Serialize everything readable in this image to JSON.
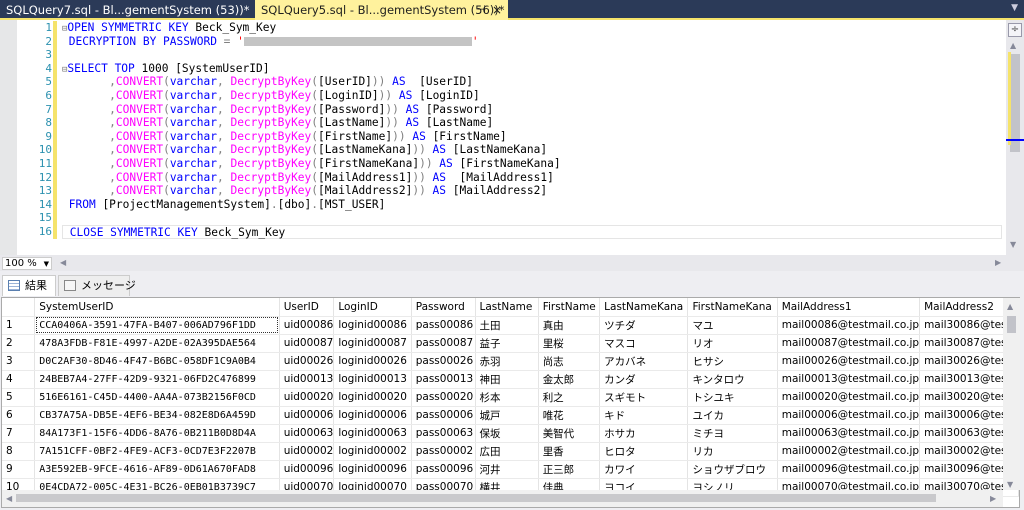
{
  "tabs": [
    {
      "label": "SQLQuery7.sql - Bl...gementSystem (53))*",
      "active": false
    },
    {
      "label": "SQLQuery5.sql - Bl...gementSystem (56))*",
      "active": true
    }
  ],
  "tab_pin_icon": "pin-icon",
  "tab_close_icon": "×",
  "editor": {
    "line_numbers": [
      "1",
      "2",
      "3",
      "4",
      "5",
      "6",
      "7",
      "8",
      "9",
      "10",
      "11",
      "12",
      "13",
      "14",
      "15",
      "16"
    ],
    "lines": [
      [
        {
          "c": "fold",
          "t": "⊟"
        },
        {
          "c": "kw",
          "t": "OPEN SYMMETRIC KEY "
        },
        {
          "c": "tx",
          "t": "Beck_Sym_Key"
        }
      ],
      [
        {
          "c": "tx",
          "t": " "
        },
        {
          "c": "kw",
          "t": "DECRYPTION BY PASSWORD "
        },
        {
          "c": "gr",
          "t": "= "
        },
        {
          "c": "str",
          "t": "'"
        },
        {
          "c": "redact",
          "t": ""
        },
        {
          "c": "str",
          "t": "'"
        }
      ],
      [],
      [
        {
          "c": "fold",
          "t": "⊟"
        },
        {
          "c": "kw",
          "t": "SELECT TOP "
        },
        {
          "c": "tx",
          "t": "1000 [SystemUserID]"
        }
      ],
      [
        {
          "c": "tx",
          "t": "       "
        },
        {
          "c": "gr",
          "t": ","
        },
        {
          "c": "fn",
          "t": "CONVERT"
        },
        {
          "c": "gr",
          "t": "("
        },
        {
          "c": "kw",
          "t": "varchar"
        },
        {
          "c": "gr",
          "t": ", "
        },
        {
          "c": "fn",
          "t": "DecryptByKey"
        },
        {
          "c": "gr",
          "t": "("
        },
        {
          "c": "tx",
          "t": "[UserID]"
        },
        {
          "c": "gr",
          "t": ")) "
        },
        {
          "c": "kw",
          "t": "AS"
        },
        {
          "c": "tx",
          "t": "  [UserID]"
        }
      ],
      [
        {
          "c": "tx",
          "t": "       "
        },
        {
          "c": "gr",
          "t": ","
        },
        {
          "c": "fn",
          "t": "CONVERT"
        },
        {
          "c": "gr",
          "t": "("
        },
        {
          "c": "kw",
          "t": "varchar"
        },
        {
          "c": "gr",
          "t": ", "
        },
        {
          "c": "fn",
          "t": "DecryptByKey"
        },
        {
          "c": "gr",
          "t": "("
        },
        {
          "c": "tx",
          "t": "[LoginID]"
        },
        {
          "c": "gr",
          "t": ")) "
        },
        {
          "c": "kw",
          "t": "AS"
        },
        {
          "c": "tx",
          "t": " [LoginID]"
        }
      ],
      [
        {
          "c": "tx",
          "t": "       "
        },
        {
          "c": "gr",
          "t": ","
        },
        {
          "c": "fn",
          "t": "CONVERT"
        },
        {
          "c": "gr",
          "t": "("
        },
        {
          "c": "kw",
          "t": "varchar"
        },
        {
          "c": "gr",
          "t": ", "
        },
        {
          "c": "fn",
          "t": "DecryptByKey"
        },
        {
          "c": "gr",
          "t": "("
        },
        {
          "c": "tx",
          "t": "[Password]"
        },
        {
          "c": "gr",
          "t": ")) "
        },
        {
          "c": "kw",
          "t": "AS"
        },
        {
          "c": "tx",
          "t": " [Password]"
        }
      ],
      [
        {
          "c": "tx",
          "t": "       "
        },
        {
          "c": "gr",
          "t": ","
        },
        {
          "c": "fn",
          "t": "CONVERT"
        },
        {
          "c": "gr",
          "t": "("
        },
        {
          "c": "kw",
          "t": "varchar"
        },
        {
          "c": "gr",
          "t": ", "
        },
        {
          "c": "fn",
          "t": "DecryptByKey"
        },
        {
          "c": "gr",
          "t": "("
        },
        {
          "c": "tx",
          "t": "[LastName]"
        },
        {
          "c": "gr",
          "t": ")) "
        },
        {
          "c": "kw",
          "t": "AS"
        },
        {
          "c": "tx",
          "t": " [LastName]"
        }
      ],
      [
        {
          "c": "tx",
          "t": "       "
        },
        {
          "c": "gr",
          "t": ","
        },
        {
          "c": "fn",
          "t": "CONVERT"
        },
        {
          "c": "gr",
          "t": "("
        },
        {
          "c": "kw",
          "t": "varchar"
        },
        {
          "c": "gr",
          "t": ", "
        },
        {
          "c": "fn",
          "t": "DecryptByKey"
        },
        {
          "c": "gr",
          "t": "("
        },
        {
          "c": "tx",
          "t": "[FirstName]"
        },
        {
          "c": "gr",
          "t": ")) "
        },
        {
          "c": "kw",
          "t": "AS"
        },
        {
          "c": "tx",
          "t": " [FirstName]"
        }
      ],
      [
        {
          "c": "tx",
          "t": "       "
        },
        {
          "c": "gr",
          "t": ","
        },
        {
          "c": "fn",
          "t": "CONVERT"
        },
        {
          "c": "gr",
          "t": "("
        },
        {
          "c": "kw",
          "t": "varchar"
        },
        {
          "c": "gr",
          "t": ", "
        },
        {
          "c": "fn",
          "t": "DecryptByKey"
        },
        {
          "c": "gr",
          "t": "("
        },
        {
          "c": "tx",
          "t": "[LastNameKana]"
        },
        {
          "c": "gr",
          "t": ")) "
        },
        {
          "c": "kw",
          "t": "AS"
        },
        {
          "c": "tx",
          "t": " [LastNameKana]"
        }
      ],
      [
        {
          "c": "tx",
          "t": "       "
        },
        {
          "c": "gr",
          "t": ","
        },
        {
          "c": "fn",
          "t": "CONVERT"
        },
        {
          "c": "gr",
          "t": "("
        },
        {
          "c": "kw",
          "t": "varchar"
        },
        {
          "c": "gr",
          "t": ", "
        },
        {
          "c": "fn",
          "t": "DecryptByKey"
        },
        {
          "c": "gr",
          "t": "("
        },
        {
          "c": "tx",
          "t": "[FirstNameKana]"
        },
        {
          "c": "gr",
          "t": ")) "
        },
        {
          "c": "kw",
          "t": "AS"
        },
        {
          "c": "tx",
          "t": " [FirstNameKana]"
        }
      ],
      [
        {
          "c": "tx",
          "t": "       "
        },
        {
          "c": "gr",
          "t": ","
        },
        {
          "c": "fn",
          "t": "CONVERT"
        },
        {
          "c": "gr",
          "t": "("
        },
        {
          "c": "kw",
          "t": "varchar"
        },
        {
          "c": "gr",
          "t": ", "
        },
        {
          "c": "fn",
          "t": "DecryptByKey"
        },
        {
          "c": "gr",
          "t": "("
        },
        {
          "c": "tx",
          "t": "[MailAddress1]"
        },
        {
          "c": "gr",
          "t": ")) "
        },
        {
          "c": "kw",
          "t": "AS"
        },
        {
          "c": "tx",
          "t": "  [MailAddress1]"
        }
      ],
      [
        {
          "c": "tx",
          "t": "       "
        },
        {
          "c": "gr",
          "t": ","
        },
        {
          "c": "fn",
          "t": "CONVERT"
        },
        {
          "c": "gr",
          "t": "("
        },
        {
          "c": "kw",
          "t": "varchar"
        },
        {
          "c": "gr",
          "t": ", "
        },
        {
          "c": "fn",
          "t": "DecryptByKey"
        },
        {
          "c": "gr",
          "t": "("
        },
        {
          "c": "tx",
          "t": "[MailAddress2]"
        },
        {
          "c": "gr",
          "t": ")) "
        },
        {
          "c": "kw",
          "t": "AS"
        },
        {
          "c": "tx",
          "t": " [MailAddress2]"
        }
      ],
      [
        {
          "c": "tx",
          "t": " "
        },
        {
          "c": "kw",
          "t": "FROM "
        },
        {
          "c": "tx",
          "t": "[ProjectManagementSystem]"
        },
        {
          "c": "gr",
          "t": "."
        },
        {
          "c": "tx",
          "t": "[dbo]"
        },
        {
          "c": "gr",
          "t": "."
        },
        {
          "c": "tx",
          "t": "[MST_USER]"
        }
      ],
      [],
      [
        {
          "c": "tx",
          "t": " "
        },
        {
          "c": "kw",
          "t": "CLOSE SYMMETRIC KEY "
        },
        {
          "c": "tx",
          "t": "Beck_Sym_Key"
        }
      ]
    ]
  },
  "zoom": {
    "value": "100 %"
  },
  "results_tabs": [
    {
      "label": "結果",
      "icon": "grid-icon"
    },
    {
      "label": "メッセージ",
      "icon": "message-icon"
    }
  ],
  "grid": {
    "columns": [
      "",
      "SystemUserID",
      "UserID",
      "LoginID",
      "Password",
      "LastName",
      "FirstName",
      "LastNameKana",
      "FirstNameKana",
      "MailAddress1",
      "MailAddress2"
    ],
    "rows": [
      [
        "1",
        "CCA0406A-3591-47FA-B407-006AD796F1DD",
        "uid00086",
        "loginid00086",
        "pass00086",
        "土田",
        "真由",
        "ツチダ",
        "マユ",
        "mail00086@testmail.co.jp",
        "mail30086@test"
      ],
      [
        "2",
        "478A3FDB-F81E-4997-A2DE-02A395DAE564",
        "uid00087",
        "loginid00087",
        "pass00087",
        "益子",
        "里桜",
        "マスコ",
        "リオ",
        "mail00087@testmail.co.jp",
        "mail30087@test"
      ],
      [
        "3",
        "D0C2AF30-8D46-4F47-B6BC-058DF1C9A0B4",
        "uid00026",
        "loginid00026",
        "pass00026",
        "赤羽",
        "尚志",
        "アカバネ",
        "ヒサシ",
        "mail00026@testmail.co.jp",
        "mail30026@test"
      ],
      [
        "4",
        "24BEB7A4-27FF-42D9-9321-06FD2C476899",
        "uid00013",
        "loginid00013",
        "pass00013",
        "神田",
        "金太郎",
        "カンダ",
        "キンタロウ",
        "mail00013@testmail.co.jp",
        "mail30013@test"
      ],
      [
        "5",
        "516E6161-C45D-4400-AA4A-073B2156F0CD",
        "uid00020",
        "loginid00020",
        "pass00020",
        "杉本",
        "利之",
        "スギモト",
        "トシユキ",
        "mail00020@testmail.co.jp",
        "mail30020@test"
      ],
      [
        "6",
        "CB37A75A-DB5E-4EF6-BE34-082E8D6A459D",
        "uid00006",
        "loginid00006",
        "pass00006",
        "城戸",
        "唯花",
        "キド",
        "ユイカ",
        "mail00006@testmail.co.jp",
        "mail30006@test"
      ],
      [
        "7",
        "84A173F1-15F6-4DD6-8A76-0B211B0D8D4A",
        "uid00063",
        "loginid00063",
        "pass00063",
        "保坂",
        "美智代",
        "ホサカ",
        "ミチヨ",
        "mail00063@testmail.co.jp",
        "mail30063@test"
      ],
      [
        "8",
        "7A151CFF-0BF2-4FE9-ACF3-0CD7E3F2207B",
        "uid00002",
        "loginid00002",
        "pass00002",
        "広田",
        "里香",
        "ヒロタ",
        "リカ",
        "mail00002@testmail.co.jp",
        "mail30002@test"
      ],
      [
        "9",
        "A3E592EB-9FCE-4616-AF89-0D61A670FAD8",
        "uid00096",
        "loginid00096",
        "pass00096",
        "河井",
        "正三郎",
        "カワイ",
        "ショウザブロウ",
        "mail00096@testmail.co.jp",
        "mail30096@test"
      ],
      [
        "10",
        "0E4CDA72-005C-4E31-BC26-0EB01B3739C7",
        "uid00070",
        "loginid00070",
        "pass00070",
        "横井",
        "佳典",
        "ヨコイ",
        "ヨシノリ",
        "mail00070@testmail.co.jp",
        "mail30070@test"
      ]
    ]
  }
}
